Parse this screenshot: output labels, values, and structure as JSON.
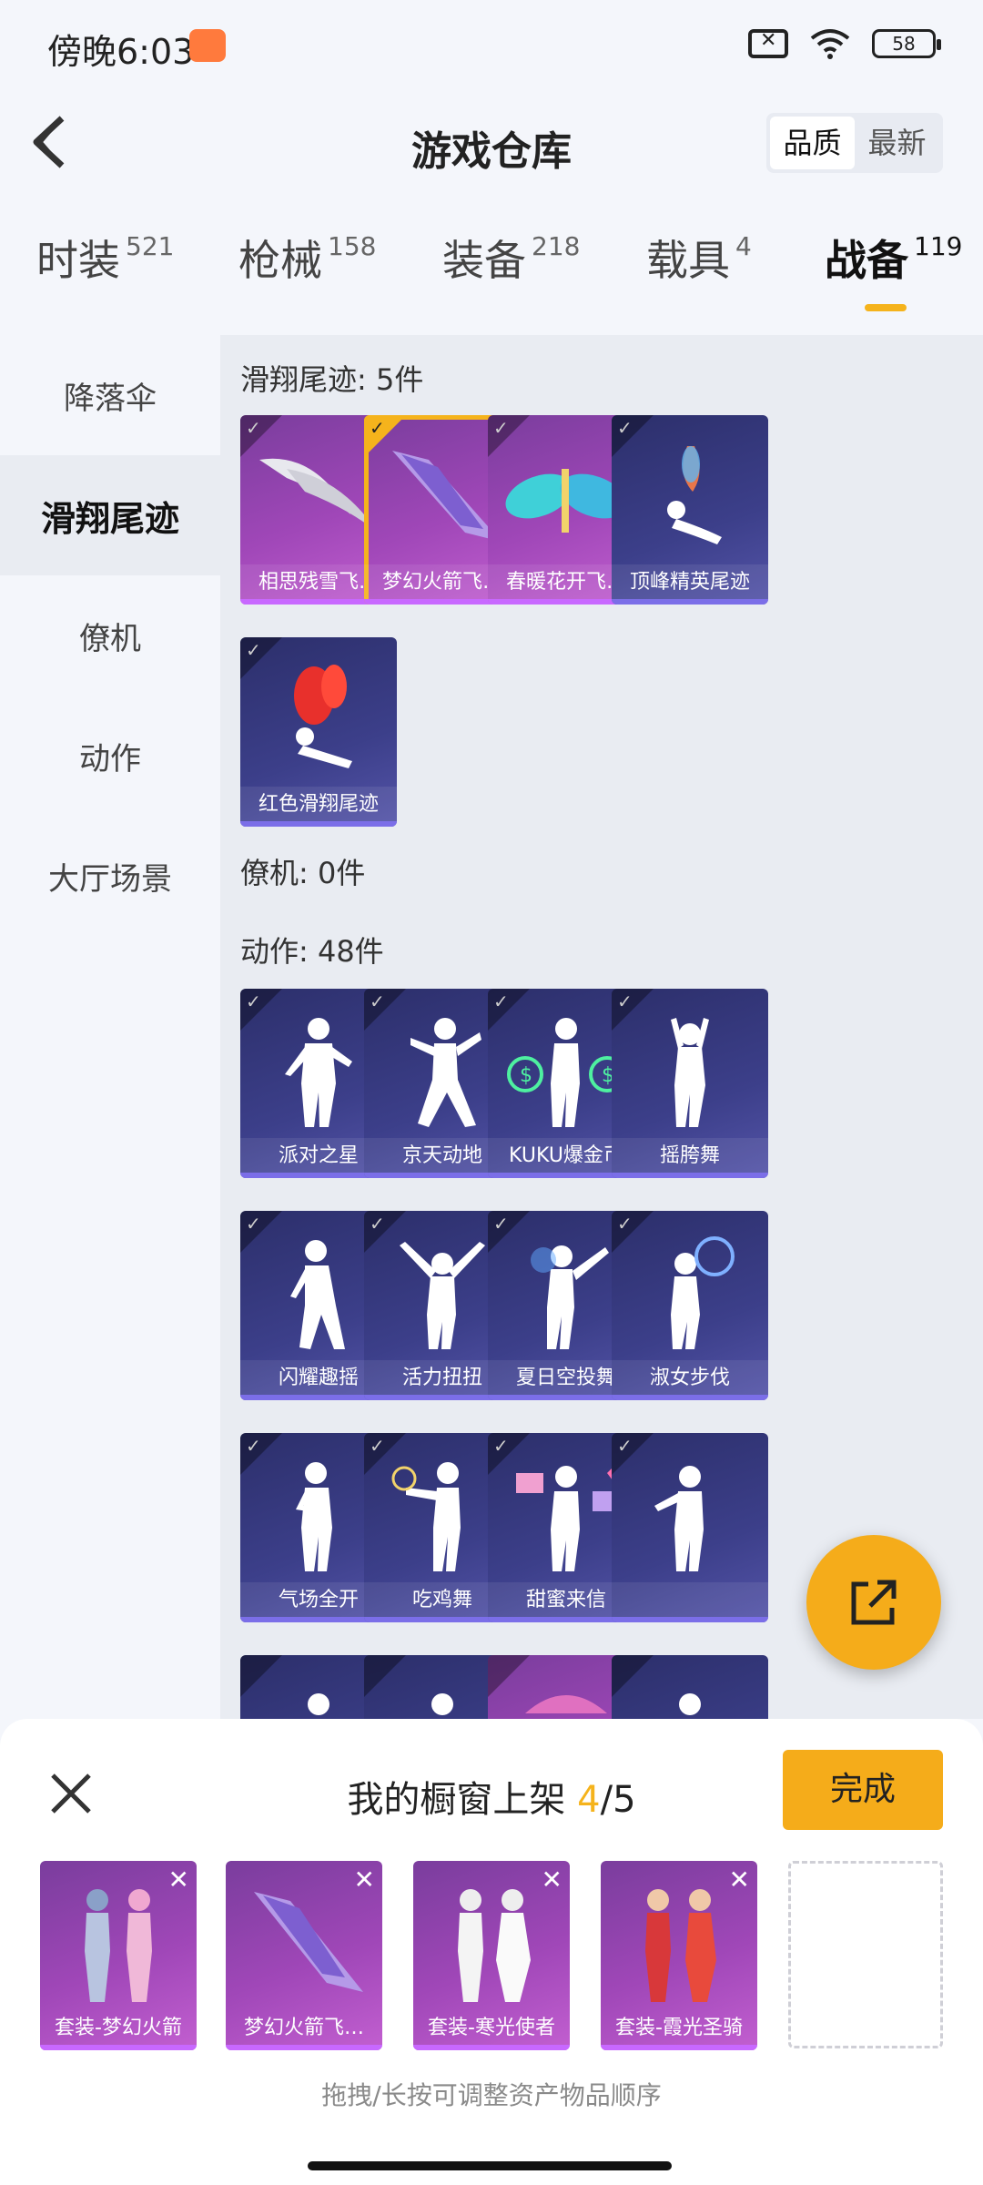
{
  "status": {
    "time": "傍晚6:03",
    "battery": "58"
  },
  "header": {
    "title": "游戏仓库",
    "sort_options": [
      "品质",
      "最新"
    ],
    "sort_active": "品质"
  },
  "category_tabs": [
    {
      "name": "时装",
      "count": "521"
    },
    {
      "name": "枪械",
      "count": "158"
    },
    {
      "name": "装备",
      "count": "218"
    },
    {
      "name": "载具",
      "count": "4"
    },
    {
      "name": "战备",
      "count": "119"
    }
  ],
  "sidebar": {
    "items": [
      "降落伞",
      "滑翔尾迹",
      "僚机",
      "动作",
      "大厅场景"
    ],
    "active": "滑翔尾迹"
  },
  "sections": {
    "trail_title": "滑翔尾迹: 5件",
    "wingman_title": "僚机: 0件",
    "action_title": "动作: 48件"
  },
  "trail_items": [
    {
      "label": "相思残雪飞…",
      "style": "purple",
      "selected": false
    },
    {
      "label": "梦幻火箭飞…",
      "style": "purple",
      "selected": true
    },
    {
      "label": "春暖花开飞…",
      "style": "purple",
      "selected": false
    },
    {
      "label": "顶峰精英尾迹",
      "style": "navy",
      "selected": false
    },
    {
      "label": "红色滑翔尾迹",
      "style": "navy",
      "selected": false
    }
  ],
  "action_items": [
    {
      "label": "派对之星"
    },
    {
      "label": "京天动地"
    },
    {
      "label": "KUKU爆金币"
    },
    {
      "label": "摇胯舞"
    },
    {
      "label": "闪耀趣摇"
    },
    {
      "label": "活力扭扭"
    },
    {
      "label": "夏日空投舞"
    },
    {
      "label": "淑女步伐"
    },
    {
      "label": "气场全开"
    },
    {
      "label": "吃鸡舞"
    },
    {
      "label": "甜蜜来信"
    },
    {
      "label": ""
    },
    {
      "label": ""
    },
    {
      "label": ""
    },
    {
      "label": ""
    },
    {
      "label": ""
    }
  ],
  "showcase": {
    "title_prefix": "我的橱窗上架 ",
    "count": "4",
    "total": "/5",
    "done_label": "完成",
    "items": [
      {
        "label": "套装-梦幻火箭"
      },
      {
        "label": "梦幻火箭飞…"
      },
      {
        "label": "套装-寒光使者"
      },
      {
        "label": "套装-霞光圣骑"
      }
    ],
    "hint": "拖拽/长按可调整资产物品顺序"
  },
  "colors": {
    "accent": "#f5b31c",
    "purple_card": "#a047b8",
    "navy_card": "#3c3f8a"
  },
  "icons": {
    "back": "chevron-left-icon",
    "share": "external-link-icon",
    "close": "close-icon",
    "check": "check-icon",
    "remove": "remove-icon"
  }
}
